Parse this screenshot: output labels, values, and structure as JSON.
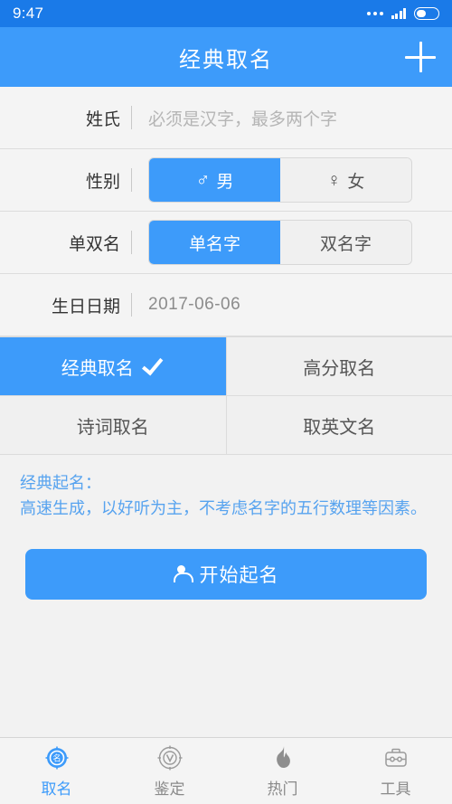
{
  "status_bar": {
    "time": "9:47",
    "dots_icon": "more-dots-icon",
    "signal_icon": "signal-bars-icon",
    "battery_icon": "battery-icon"
  },
  "header": {
    "title": "经典取名",
    "add_icon": "plus-icon"
  },
  "form": {
    "surname": {
      "label": "姓氏",
      "placeholder": "必须是汉字，最多两个字",
      "value": ""
    },
    "gender": {
      "label": "性别",
      "options": [
        {
          "label": "男",
          "icon": "male-symbol-icon",
          "glyph": "♂",
          "selected": true
        },
        {
          "label": "女",
          "icon": "female-symbol-icon",
          "glyph": "♀",
          "selected": false
        }
      ]
    },
    "name_length": {
      "label": "单双名",
      "options": [
        {
          "label": "单名字",
          "selected": true
        },
        {
          "label": "双名字",
          "selected": false
        }
      ]
    },
    "birthday": {
      "label": "生日日期",
      "value": "2017-06-06"
    }
  },
  "methods": [
    {
      "label": "经典取名",
      "selected": true,
      "check_icon": "checkmark-icon"
    },
    {
      "label": "高分取名",
      "selected": false
    },
    {
      "label": "诗词取名",
      "selected": false
    },
    {
      "label": "取英文名",
      "selected": false
    }
  ],
  "description": {
    "title": "经典起名：",
    "body": "高速生成，以好听为主，不考虑名字的五行数理等因素。"
  },
  "primary_action": {
    "label": "开始起名",
    "icon": "person-icon"
  },
  "tabbar": [
    {
      "label": "取名",
      "icon": "name-compass-icon",
      "active": true
    },
    {
      "label": "鉴定",
      "icon": "appraisal-circle-icon",
      "active": false
    },
    {
      "label": "热门",
      "icon": "flame-icon",
      "active": false
    },
    {
      "label": "工具",
      "icon": "toolbox-icon",
      "active": false
    }
  ],
  "colors": {
    "accent": "#3d9bfa",
    "status_bar": "#1a7ae8",
    "page_background": "#f2f2f2",
    "row_background": "#f4f4f4",
    "description_text": "#57a3ef",
    "inactive_text": "#8a8a8a"
  }
}
